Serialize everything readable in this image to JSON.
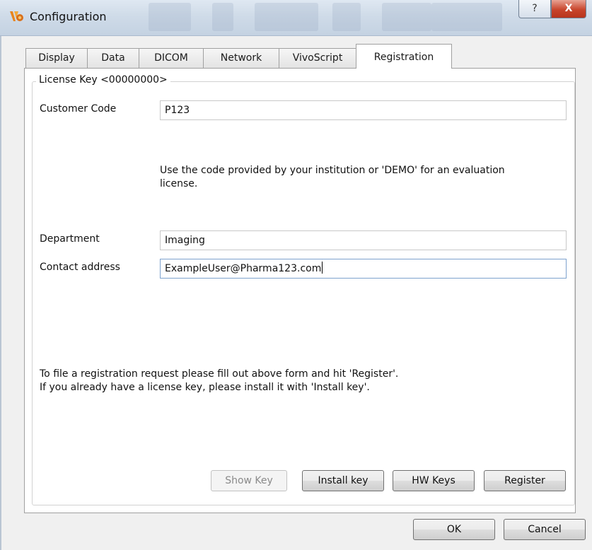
{
  "window": {
    "title": "Configuration",
    "help_label": "?",
    "close_label": "X"
  },
  "tabs": [
    {
      "label": "Display"
    },
    {
      "label": "Data"
    },
    {
      "label": "DICOM"
    },
    {
      "label": "Network"
    },
    {
      "label": "VivoScript"
    },
    {
      "label": "Registration",
      "active": true
    }
  ],
  "registration": {
    "group_title": "License Key <00000000>",
    "customer_code_label": "Customer Code",
    "customer_code_value": "P123",
    "customer_code_hint_line1": "Use the code provided by your institution or 'DEMO' for an evaluation",
    "customer_code_hint_line2": "license.",
    "department_label": "Department",
    "department_value": "Imaging",
    "contact_label": "Contact address",
    "contact_value": "ExampleUser@Pharma123.com",
    "instructions_line1": "To file a registration request please fill out above form and hit 'Register'.",
    "instructions_line2": "If you already have a license key, please install it with 'Install key'.",
    "buttons": {
      "show_key": "Show Key",
      "install_key": "Install key",
      "hw_keys": "HW Keys",
      "register": "Register"
    }
  },
  "dialog_buttons": {
    "ok": "OK",
    "cancel": "Cancel"
  },
  "colors": {
    "accent_focus_border": "#7da2ce",
    "close_button": "#c8452c",
    "app_icon_orange": "#e8851c"
  }
}
